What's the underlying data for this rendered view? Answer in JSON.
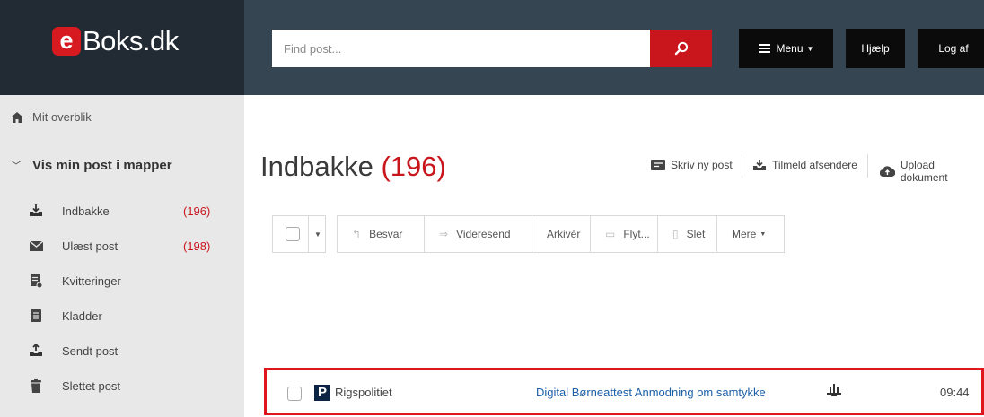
{
  "header": {
    "logo_letter": "e",
    "logo_text": "Boks.dk",
    "search": {
      "placeholder": "Find post...",
      "value": ""
    },
    "menu_label": "Menu",
    "help_label": "Hjælp",
    "logout_label": "Log af"
  },
  "sidebar": {
    "overview_label": "Mit overblik",
    "section_title": "Vis min post i mapper",
    "items": [
      {
        "label": "Indbakke",
        "count": "(196)",
        "icon": "inbox-icon"
      },
      {
        "label": "Ulæst post",
        "count": "(198)",
        "icon": "envelope-icon"
      },
      {
        "label": "Kvitteringer",
        "count": "",
        "icon": "receipt-icon"
      },
      {
        "label": "Kladder",
        "count": "",
        "icon": "draft-icon"
      },
      {
        "label": "Sendt post",
        "count": "",
        "icon": "sent-icon"
      },
      {
        "label": "Slettet post",
        "count": "",
        "icon": "trash-icon"
      }
    ]
  },
  "main": {
    "title": "Indbakke",
    "title_count": "(196)",
    "actions": {
      "write": "Skriv ny post",
      "subscribe": "Tilmeld afsendere",
      "upload": "Upload dokument"
    },
    "toolbar": {
      "reply": "Besvar",
      "forward": "Videresend",
      "archive": "Arkivér",
      "move": "Flyt...",
      "delete": "Slet",
      "more": "Mere"
    },
    "messages": [
      {
        "sender_logo": "P",
        "sender": "Rigspolitiet",
        "subject": "Digital Børneattest Anmodning om samtykke",
        "time": "09:44"
      }
    ]
  },
  "colors": {
    "brand_red": "#c9161d",
    "header_dark": "#222b33",
    "header_bar": "#354551",
    "sidebar_bg": "#e8e8e8",
    "highlight": "#e0161d",
    "link_blue": "#1c5fa8"
  }
}
